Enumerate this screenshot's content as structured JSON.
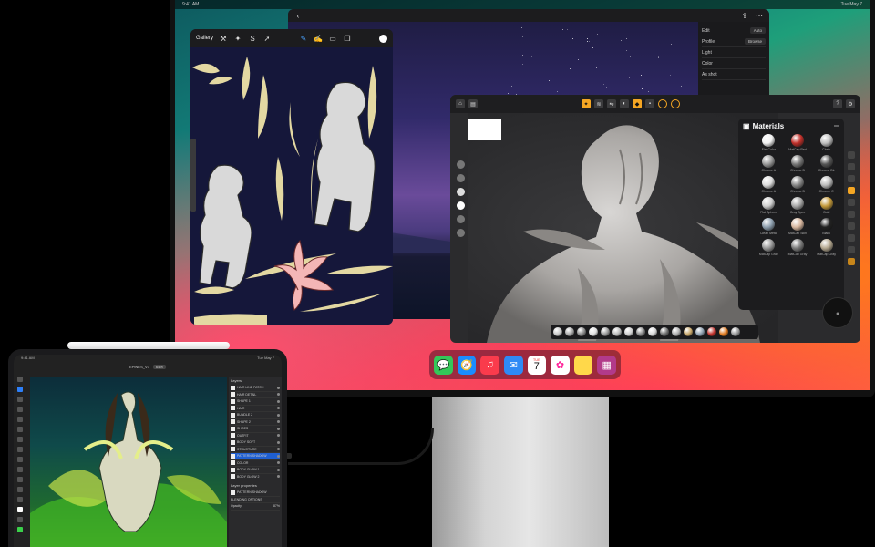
{
  "monitor": {
    "menubar": {
      "left": "9:41 AM",
      "date": "Tue May 7"
    }
  },
  "back_window": {
    "panel_rows": [
      {
        "label": "Edit",
        "button": "Auto"
      },
      {
        "label": "Profile",
        "button": "Browse"
      },
      {
        "label": "Light",
        "button": ""
      },
      {
        "label": "Color",
        "button": ""
      },
      {
        "label": "As shot",
        "button": ""
      }
    ]
  },
  "draw_window": {
    "gallery_label": "Gallery"
  },
  "sculpt_window": {
    "materials_title": "Materials",
    "materials": [
      {
        "name": "Flat Color",
        "color": "#f2f2f2"
      },
      {
        "name": "MatCap Red",
        "color": "#c0302a"
      },
      {
        "name": "Chalk",
        "color": "#bfbfbf"
      },
      {
        "name": "Chrome A",
        "color": "#9a9a9a"
      },
      {
        "name": "Chrome B",
        "color": "#777777"
      },
      {
        "name": "Chrome Dk",
        "color": "#555555"
      },
      {
        "name": "Chrome A",
        "color": "#dddddd"
      },
      {
        "name": "Chrome B",
        "color": "#888888"
      },
      {
        "name": "Chrome C",
        "color": "#bbbbbb"
      },
      {
        "name": "Flat Sphere",
        "color": "#cfcfcf"
      },
      {
        "name": "Gray Spec",
        "color": "#a8a8a8"
      },
      {
        "name": "Gold",
        "color": "#c49a3a"
      },
      {
        "name": "Clean Metal",
        "color": "#8fa0b0"
      },
      {
        "name": "MatCap Skin",
        "color": "#d9b8a0"
      },
      {
        "name": "Black",
        "color": "#222222"
      },
      {
        "name": "MatCap Gray",
        "color": "#9a9a9a"
      },
      {
        "name": "MatCap Gray",
        "color": "#7d7d7d"
      },
      {
        "name": "MatCap Gray",
        "color": "#b5a890"
      }
    ],
    "bar_colors": [
      "#c8c8c8",
      "#aaaaaa",
      "#8a8a8a",
      "#e0e0e0",
      "#999999",
      "#bbbbbb",
      "#cfcfcf",
      "#888888",
      "#d6d6d6",
      "#6f6f6f",
      "#b0b0b0",
      "#c9a86a",
      "#8fa0b0",
      "#c0302a",
      "#e07a20",
      "#9a9a9a"
    ]
  },
  "dock": {
    "apps": [
      {
        "name": "messages-app",
        "glyph": "💬",
        "color": "#34c759"
      },
      {
        "name": "safari-app",
        "glyph": "🧭",
        "color": "#1a8cff"
      },
      {
        "name": "music-app",
        "glyph": "♫",
        "color": "#fa3b4c"
      },
      {
        "name": "mail-app",
        "glyph": "✉",
        "color": "#2f8af5"
      },
      {
        "name": "calendar-app",
        "glyph": "7",
        "color": "#ffffff"
      },
      {
        "name": "photos-app",
        "glyph": "✿",
        "color": "#ffffff"
      },
      {
        "name": "notes-app",
        "glyph": "",
        "color": "#ffd84a"
      },
      {
        "name": "apps-folder",
        "glyph": "▦",
        "color": "#b23a8a"
      }
    ],
    "calendar_day": "TUE",
    "calendar_date": "7"
  },
  "ipad": {
    "status_left": "9:41 AM",
    "status_date": "Tue May 7",
    "doc_title": "EPINES_V3",
    "doc_zoom": "64%",
    "layers_title": "Layers",
    "layers": [
      {
        "name": "HAIR LINE PATCH",
        "selected": false
      },
      {
        "name": "HAIR DETAIL",
        "selected": false
      },
      {
        "name": "SHAPE 1",
        "selected": false
      },
      {
        "name": "HAIR",
        "selected": false
      },
      {
        "name": "BUNDLE 2",
        "selected": false
      },
      {
        "name": "SHAPE 2",
        "selected": false
      },
      {
        "name": "SHOES",
        "selected": false
      },
      {
        "name": "OUTFIT",
        "selected": false
      },
      {
        "name": "BODY SOFT",
        "selected": false
      },
      {
        "name": "STRUCTURE",
        "selected": false
      },
      {
        "name": "PATTERN SHADOW",
        "selected": true
      },
      {
        "name": "COLOR",
        "selected": false
      },
      {
        "name": "BODY GLOW 1",
        "selected": false
      },
      {
        "name": "BODY GLOW 2",
        "selected": false
      }
    ],
    "layer_props": "Layer properties",
    "layer_name": "PATTERN SHADOW",
    "blending": "BLENDING OPTIONS",
    "opacity_label": "Opacity",
    "opacity_value": "87%"
  }
}
